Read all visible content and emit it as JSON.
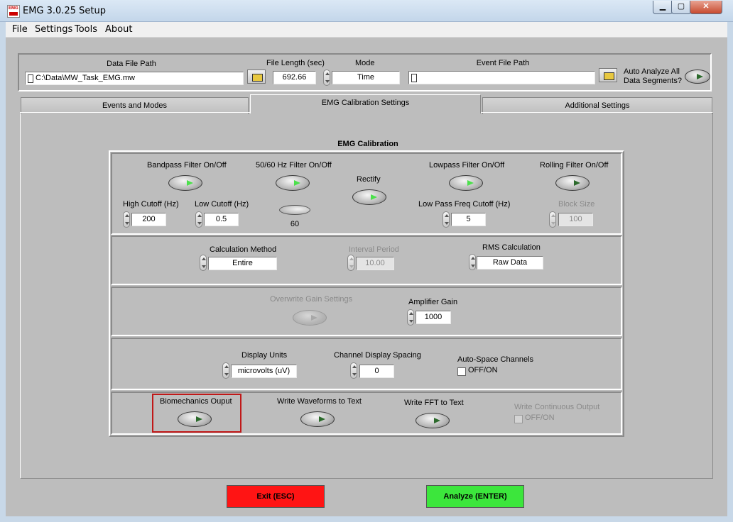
{
  "window": {
    "title": "EMG 3.0.25 Setup"
  },
  "menu": [
    "File",
    "Settings",
    "Tools",
    "About"
  ],
  "top": {
    "data_file_label": "Data File Path",
    "data_file_value": "C:\\Data\\MW_Task_EMG.mw",
    "file_length_label": "File Length (sec)",
    "file_length_value": "692.66",
    "mode_label": "Mode",
    "mode_value": "Time",
    "event_file_label": "Event File Path",
    "event_file_value": "",
    "auto_analyze_label_1": "Auto Analyze All",
    "auto_analyze_label_2": "Data Segments?"
  },
  "tabs": [
    "Events and Modes",
    "EMG Calibration Settings",
    "Additional Settings"
  ],
  "calibration": {
    "heading": "EMG Calibration",
    "bandpass_label": "Bandpass Filter On/Off",
    "notch_label": "50/60 Hz Filter On/Off",
    "rectify_label": "Rectify",
    "lowpass_label": "Lowpass Filter On/Off",
    "rolling_label": "Rolling Filter On/Off",
    "high_cutoff_label": "High Cutoff (Hz)",
    "high_cutoff_value": "200",
    "low_cutoff_label": "Low Cutoff (Hz)",
    "low_cutoff_value": "0.5",
    "notch_freq_value": "60",
    "lowpass_cutoff_label": "Low Pass Freq Cutoff (Hz)",
    "lowpass_cutoff_value": "5",
    "block_size_label": "Block Size",
    "block_size_value": "100",
    "calc_method_label": "Calculation  Method",
    "calc_method_value": "Entire",
    "interval_label": "Interval Period",
    "interval_value": "10.00",
    "rms_label": "RMS Calculation",
    "rms_value": "Raw Data",
    "overwrite_gain_label": "Overwrite Gain Settings",
    "amp_gain_label": "Amplifier Gain",
    "amp_gain_value": "1000",
    "display_units_label": "Display Units",
    "display_units_value": "microvolts (uV)",
    "channel_spacing_label": "Channel Display Spacing",
    "channel_spacing_value": "0",
    "auto_space_label": "Auto-Space Channels",
    "auto_space_checkbox": "OFF/ON",
    "biomech_label": "Biomechanics Ouput",
    "waveforms_label": "Write Waveforms to Text",
    "fft_label": "Write FFT to Text",
    "continuous_label": "Write Continuous Output",
    "continuous_checkbox": "OFF/ON"
  },
  "buttons": {
    "exit": "Exit (ESC)",
    "analyze": "Analyze (ENTER)"
  },
  "colors": {
    "exit": "#ff1414",
    "analyze": "#3ce63c",
    "highlight": "#c01818"
  }
}
